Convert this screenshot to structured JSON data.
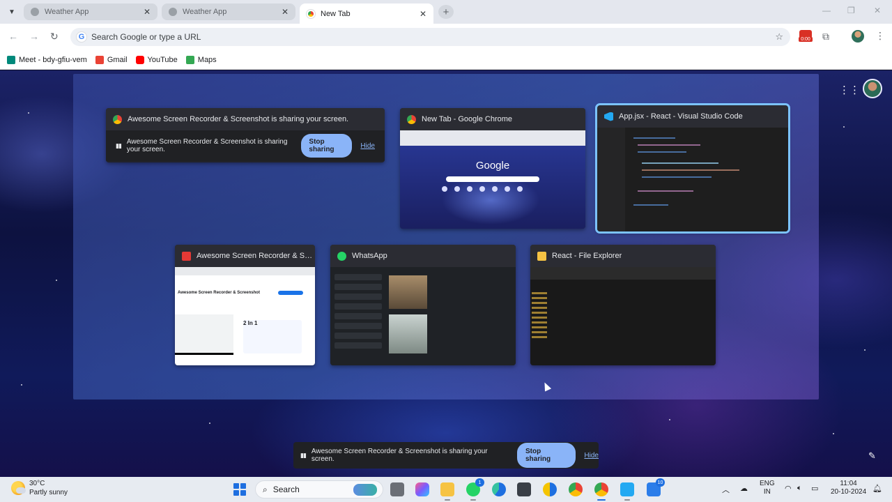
{
  "browser": {
    "tabs": [
      {
        "title": "Weather App",
        "active": false
      },
      {
        "title": "Weather App",
        "active": false
      },
      {
        "title": "New Tab",
        "active": true
      }
    ],
    "close_glyph": "✕",
    "new_tab_glyph": "+",
    "omnibox_placeholder": "Search Google or type a URL",
    "recorder_badge": "0:00",
    "bookmarks": [
      {
        "label": "Meet - bdy-gfiu-vem",
        "color": "#00897b"
      },
      {
        "label": "Gmail",
        "color": "#ea4335"
      },
      {
        "label": "YouTube",
        "color": "#ff0000"
      },
      {
        "label": "Maps",
        "color": "#34a853"
      }
    ]
  },
  "picker": {
    "windows": [
      {
        "title": "Awesome Screen Recorder & Screenshot is sharing your screen.",
        "icon": "chrome-icon"
      },
      {
        "title": "New Tab - Google Chrome",
        "icon": "chrome-icon"
      },
      {
        "title": "App.jsx - React - Visual Studio Code",
        "icon": "vscode-icon",
        "selected": true
      },
      {
        "title": "Awesome Screen Recorder & Scre...",
        "icon": "recorder-icon"
      },
      {
        "title": "WhatsApp",
        "icon": "whatsapp-icon"
      },
      {
        "title": "React - File Explorer",
        "icon": "folder-icon"
      }
    ],
    "mini_share_text": "Awesome Screen Recorder & Screenshot is sharing your screen.",
    "mini_stop": "Stop sharing",
    "mini_hide": "Hide",
    "thumb_google": "Google",
    "thumb_rec_heading": "Awesome Screen Recorder & Screenshot",
    "thumb_rec_2in1": "2 In 1"
  },
  "sharing_bar": {
    "text": "Awesome Screen Recorder & Screenshot is sharing your screen.",
    "stop": "Stop sharing",
    "hide": "Hide"
  },
  "taskbar": {
    "temp": "30°C",
    "condition": "Partly sunny",
    "search_label": "Search",
    "whatsapp_badge": "1",
    "store_badge": "10",
    "lang_top": "ENG",
    "lang_bottom": "IN",
    "time": "11:04",
    "date": "20-10-2024"
  },
  "colors": {
    "accent": "#8ab4f8",
    "selected_outline": "#7cc3ff",
    "windows_blue": "#1e6fe0"
  }
}
